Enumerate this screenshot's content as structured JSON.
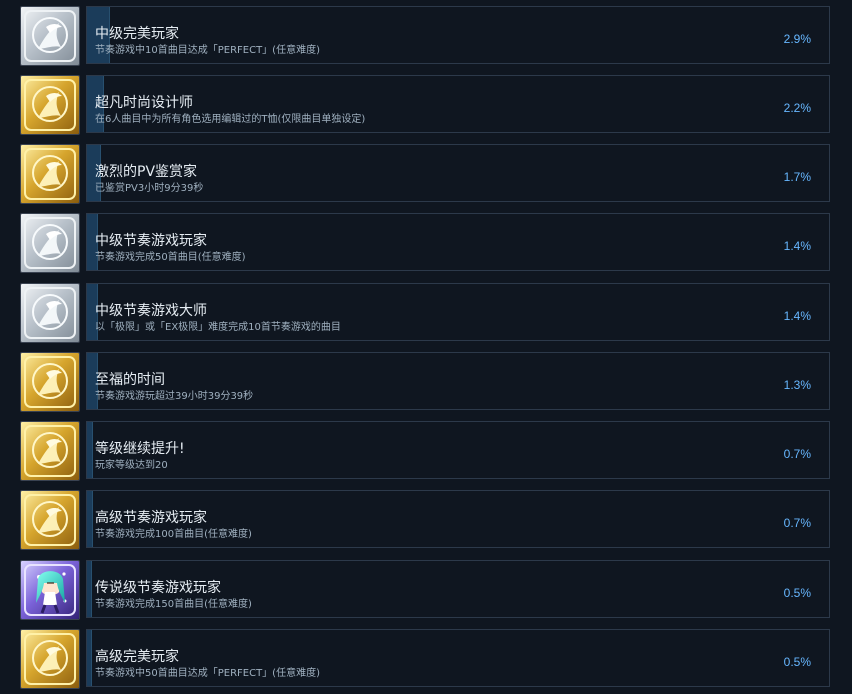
{
  "achievements": [
    {
      "title": "中级完美玩家",
      "description": "节奏游戏中10首曲目达成「PERFECT」(任意难度)",
      "percent": "2.9%",
      "progress_percent": 2.9,
      "icon": "silver-trophy-icon"
    },
    {
      "title": "超凡时尚设计师",
      "description": "在6人曲目中为所有角色选用编辑过的T恤(仅限曲目单独设定)",
      "percent": "2.2%",
      "progress_percent": 2.2,
      "icon": "gold-trophy-icon"
    },
    {
      "title": "激烈的PV鉴赏家",
      "description": "已鉴赏PV3小时9分39秒",
      "percent": "1.7%",
      "progress_percent": 1.7,
      "icon": "gold-trophy-icon"
    },
    {
      "title": "中级节奏游戏玩家",
      "description": "节奏游戏完成50首曲目(任意难度)",
      "percent": "1.4%",
      "progress_percent": 1.4,
      "icon": "silver-trophy-icon"
    },
    {
      "title": "中级节奏游戏大师",
      "description": "以「极限」或「EX极限」难度完成10首节奏游戏的曲目",
      "percent": "1.4%",
      "progress_percent": 1.4,
      "icon": "silver-trophy-icon"
    },
    {
      "title": "至福的时间",
      "description": "节奏游戏游玩超过39小时39分39秒",
      "percent": "1.3%",
      "progress_percent": 1.3,
      "icon": "gold-trophy-icon"
    },
    {
      "title": "等级继续提升!",
      "description": "玩家等级达到20",
      "percent": "0.7%",
      "progress_percent": 0.7,
      "icon": "gold-trophy-icon"
    },
    {
      "title": "高级节奏游戏玩家",
      "description": "节奏游戏完成100首曲目(任意难度)",
      "percent": "0.7%",
      "progress_percent": 0.7,
      "icon": "gold-trophy-icon"
    },
    {
      "title": "传说级节奏游戏玩家",
      "description": "节奏游戏完成150首曲目(任意难度)",
      "percent": "0.5%",
      "progress_percent": 0.5,
      "icon": "legendary-character-icon"
    },
    {
      "title": "高级完美玩家",
      "description": "节奏游戏中50首曲目达成「PERFECT」(任意难度)",
      "percent": "0.5%",
      "progress_percent": 0.5,
      "icon": "gold-trophy-icon"
    }
  ],
  "colors": {
    "background": "#0f1620",
    "card_border": "#2c394a",
    "progress_fill": "#1b3c5a",
    "title": "#e6edf3",
    "description": "#9fb0bf",
    "percent": "#67b7ff",
    "gold": "#d4a72c",
    "silver": "#b9c0c8",
    "legendary": "#7c67d9"
  }
}
